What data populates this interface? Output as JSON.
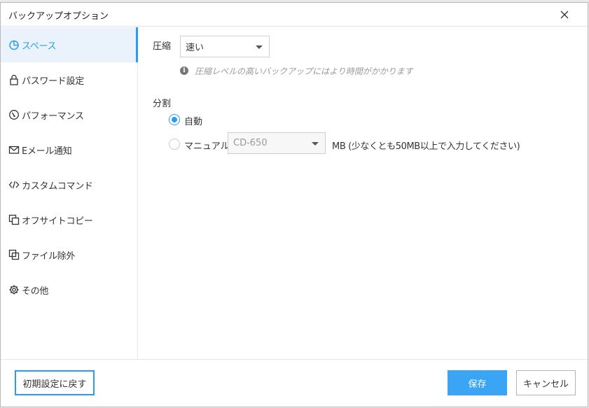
{
  "window": {
    "title": "バックアップオプション"
  },
  "sidebar": {
    "items": [
      {
        "label": "スペース",
        "icon": "pie-chart-icon",
        "active": true
      },
      {
        "label": "パスワード設定",
        "icon": "lock-icon",
        "active": false
      },
      {
        "label": "パフォーマンス",
        "icon": "gauge-icon",
        "active": false
      },
      {
        "label": "Eメール通知",
        "icon": "mail-icon",
        "active": false
      },
      {
        "label": "カスタムコマンド",
        "icon": "code-icon",
        "active": false
      },
      {
        "label": "オフサイトコピー",
        "icon": "copy-icon",
        "active": false
      },
      {
        "label": "ファイル除外",
        "icon": "exclude-icon",
        "active": false
      },
      {
        "label": "その他",
        "icon": "gear-icon",
        "active": false
      }
    ]
  },
  "compression": {
    "label": "圧縮",
    "selected": "速い",
    "hint": "圧縮レベルの高いバックアップにはより時間がかかります"
  },
  "split": {
    "label": "分割",
    "auto_label": "自動",
    "auto_checked": true,
    "manual_label": "マニュアル",
    "manual_checked": false,
    "manual_selected": "CD-650",
    "manual_note": "MB (少なくとも50MB以上で入力してください)"
  },
  "footer": {
    "reset_label": "初期設定に戻す",
    "save_label": "保存",
    "cancel_label": "キャンセル"
  },
  "colors": {
    "accent": "#2d9cf0",
    "save_button": "#3ba5f5",
    "active_bg": "#eaf3fc"
  }
}
